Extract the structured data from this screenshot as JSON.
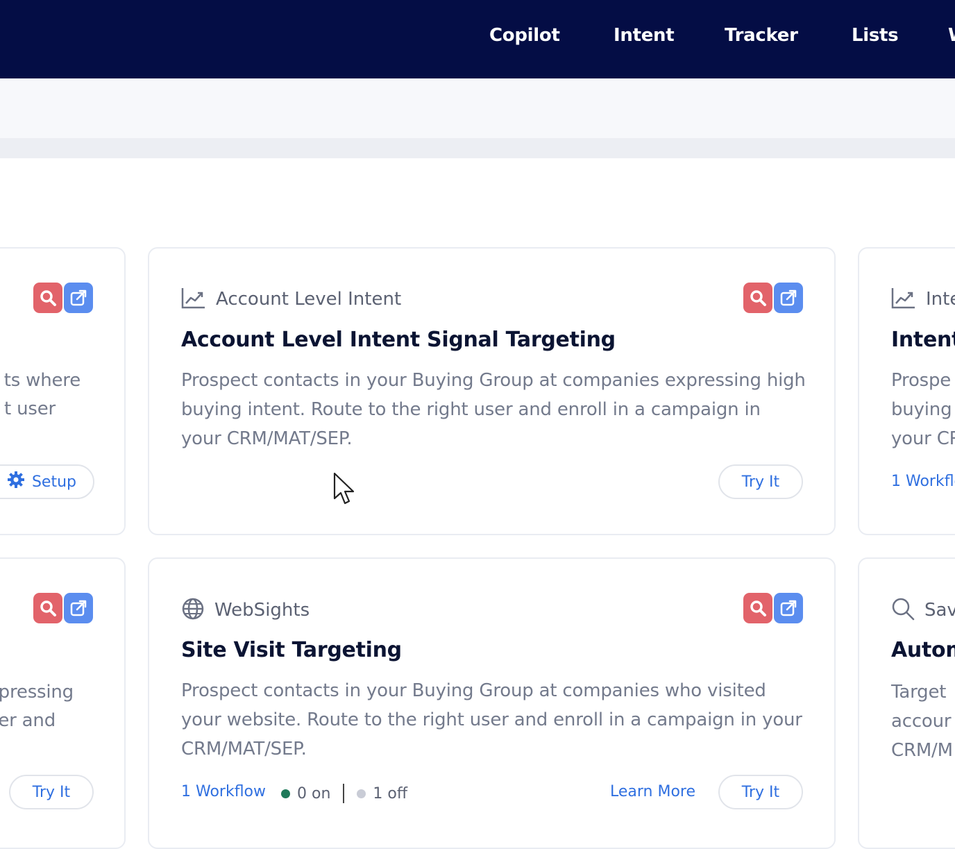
{
  "colors": {
    "nav_bg": "#040d45",
    "accent_blue": "#2f6fe0",
    "badge_red": "#e2636a",
    "badge_blue": "#5b8def",
    "status_on": "#1f7a5a",
    "status_off": "#c9ccd6"
  },
  "nav": {
    "items": [
      "Copilot",
      "Intent",
      "Tracker",
      "Lists",
      "W"
    ]
  },
  "cards": {
    "left_top": {
      "desc_lines": [
        "ts where",
        "t user"
      ],
      "setup_label": "Setup",
      "icons": [
        "search-icon",
        "export-icon"
      ]
    },
    "center_top": {
      "category": "Account Level Intent",
      "category_icon": "trend-chart-icon",
      "title": "Account Level Intent Signal Targeting",
      "desc": "Prospect contacts in your Buying Group at companies expressing high buying intent. Route to the right user and enroll in a campaign in your CRM/MAT/SEP.",
      "try_label": "Try It",
      "icons": [
        "search-icon",
        "export-icon"
      ]
    },
    "right_top": {
      "category": "Inte",
      "category_icon": "trend-chart-icon",
      "title": "Intent",
      "desc_lines": [
        "Prospe",
        "buying",
        "your CR"
      ],
      "workflow": "1 Workflo"
    },
    "left_bottom": {
      "desc_lines": [
        "pressing",
        "er and"
      ],
      "try_label": "Try It",
      "icons": [
        "search-icon",
        "export-icon"
      ]
    },
    "center_bottom": {
      "category": "WebSights",
      "category_icon": "globe-icon",
      "title": "Site Visit Targeting",
      "desc": "Prospect contacts in your Buying Group at companies who visited your website. Route to the right user and enroll in a campaign in your CRM/MAT/SEP.",
      "workflow": "1 Workflow",
      "on_text": "0 on",
      "off_text": "1 off",
      "learn_more": "Learn More",
      "try_label": "Try It",
      "icons": [
        "search-icon",
        "export-icon"
      ]
    },
    "right_bottom": {
      "category": "Sav",
      "category_icon": "magnifier-icon",
      "title": "Autom",
      "desc_lines": [
        "Target",
        "accour",
        "CRM/M"
      ]
    }
  }
}
